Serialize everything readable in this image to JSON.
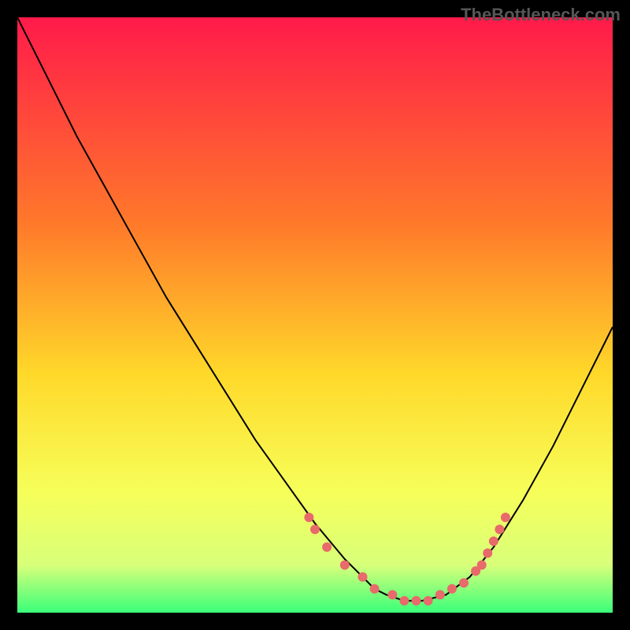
{
  "watermark": "TheBottleneck.com",
  "chart_data": {
    "type": "line",
    "title": "",
    "xlabel": "",
    "ylabel": "",
    "xlim": [
      0,
      100
    ],
    "ylim": [
      0,
      100
    ],
    "gradient_stops": [
      {
        "offset": 0,
        "color": "#ff1a4a"
      },
      {
        "offset": 35,
        "color": "#ff7a2a"
      },
      {
        "offset": 60,
        "color": "#ffd92a"
      },
      {
        "offset": 80,
        "color": "#f6ff5a"
      },
      {
        "offset": 92,
        "color": "#d8ff7a"
      },
      {
        "offset": 100,
        "color": "#3aff7a"
      }
    ],
    "curve": {
      "x": [
        0,
        5,
        10,
        15,
        20,
        25,
        30,
        35,
        40,
        45,
        50,
        55,
        58,
        60,
        62,
        65,
        68,
        72,
        76,
        80,
        85,
        90,
        95,
        100
      ],
      "y": [
        100,
        90,
        80,
        71,
        62,
        53,
        45,
        37,
        29,
        22,
        15,
        9,
        6,
        4,
        3,
        2,
        2,
        3,
        6,
        11,
        19,
        28,
        38,
        48
      ]
    },
    "markers": {
      "x": [
        49,
        50,
        52,
        55,
        58,
        60,
        63,
        65,
        67,
        69,
        71,
        73,
        75,
        77,
        78,
        79,
        80,
        81,
        82
      ],
      "y": [
        16,
        14,
        11,
        8,
        6,
        4,
        3,
        2,
        2,
        2,
        3,
        4,
        5,
        7,
        8,
        10,
        12,
        14,
        16
      ],
      "color": "#e86a6a",
      "size": 6
    }
  }
}
